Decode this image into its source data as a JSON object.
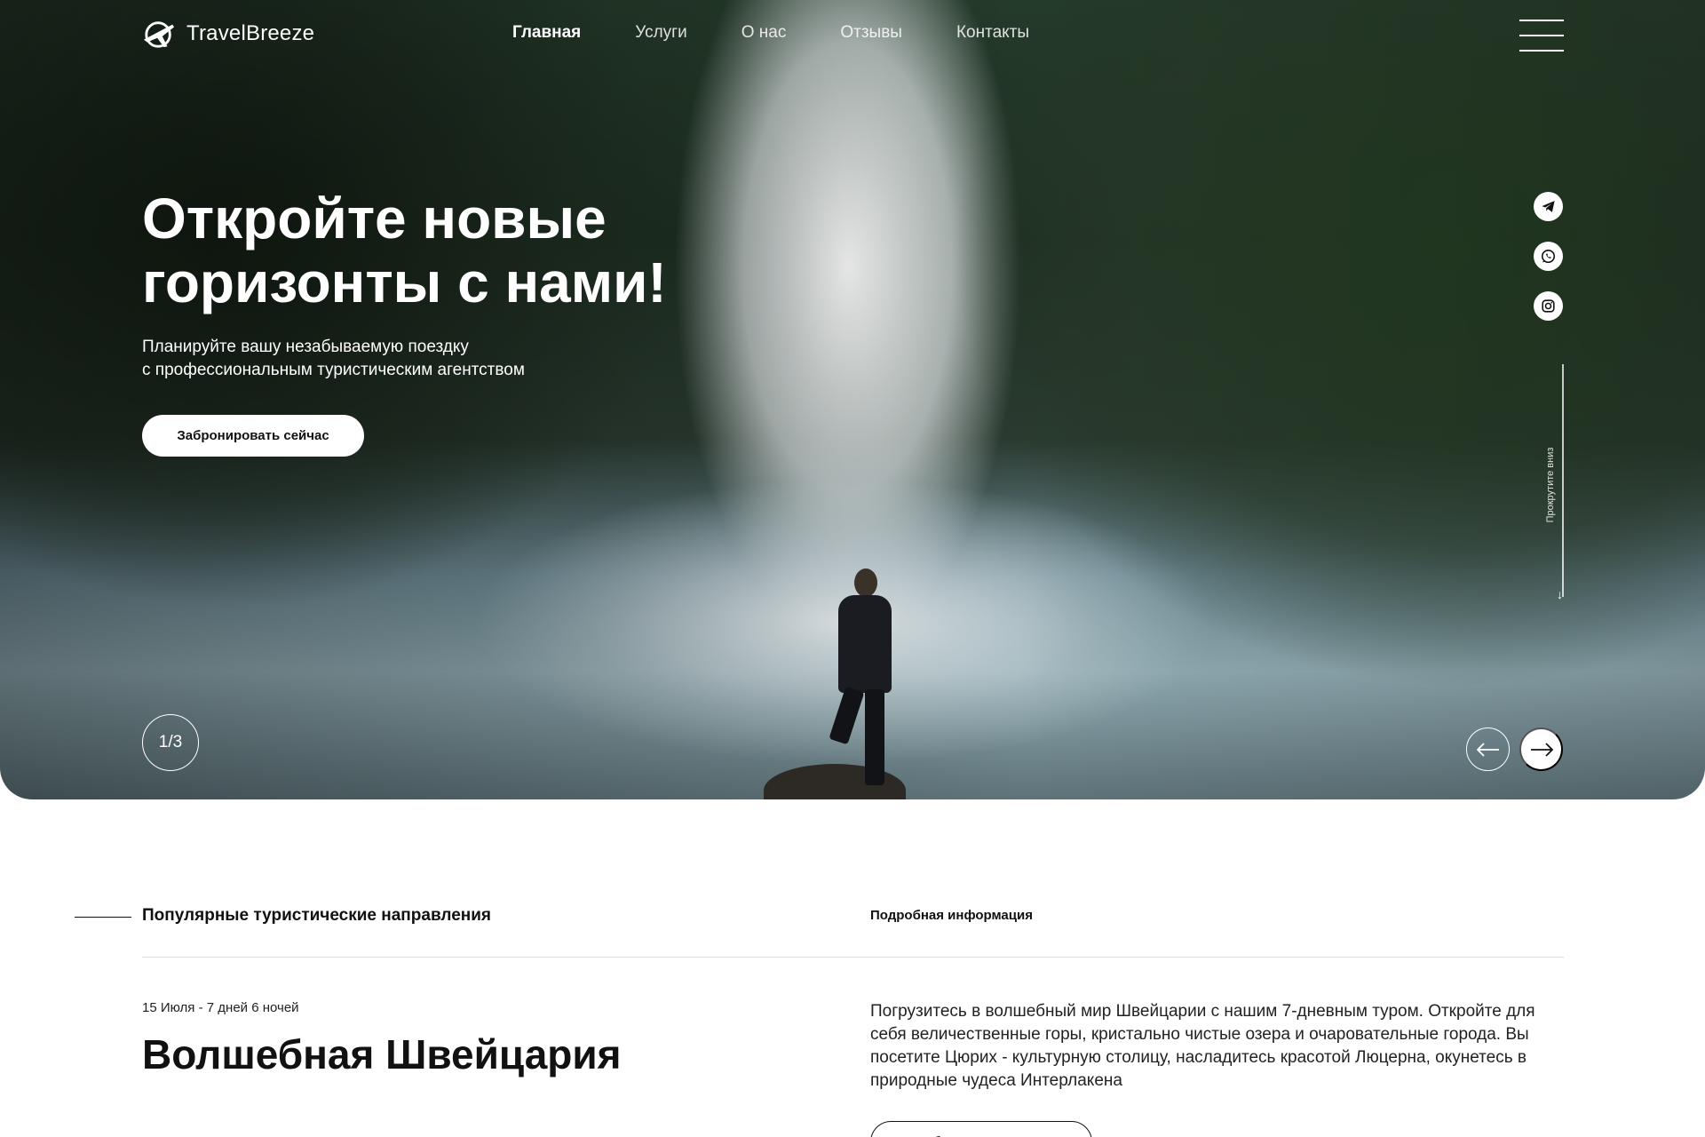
{
  "brand": {
    "name": "TravelBreeze",
    "logo_icon": "plane-globe-icon"
  },
  "nav": {
    "items": [
      {
        "label": "Главная",
        "active": true
      },
      {
        "label": "Услуги",
        "active": false
      },
      {
        "label": "О нас",
        "active": false
      },
      {
        "label": "Отзывы",
        "active": false
      },
      {
        "label": "Контакты",
        "active": false
      }
    ],
    "menu_icon": "hamburger-menu-icon"
  },
  "hero": {
    "title": "Откройте новые горизонты с нами!",
    "subtitle_line1": "Планируйте вашу незабываемую поездку",
    "subtitle_line2": "с профессиональным туристическим агентством",
    "cta_label": "Забронировать сейчас",
    "slide_counter": "1/3",
    "scroll_hint": "Прокрутите вниз",
    "socials": [
      "telegram-icon",
      "whatsapp-icon",
      "instagram-icon"
    ],
    "prev_icon": "arrow-left-icon",
    "next_icon": "arrow-right-icon"
  },
  "section": {
    "title": "Популярные туристические направления",
    "more_label": "Подробная информация"
  },
  "tour": {
    "date": "15 Июля",
    "duration": " - 7 дней 6 ночей",
    "title": "Волшебная Швейцария",
    "description": "Погрузитесь в волшебный мир Швейцарии с нашим 7-дневным туром. Откройте для себя величественные горы, кристально чистые озера и очаровательные города. Вы посетите Цюрих - культурную столицу, насладитесь красотой Люцерна, окунетесь в природные чудеса Интерлакена",
    "button_label": "Забронировать тур"
  },
  "colors": {
    "accent": "#ffffff",
    "text": "#111111",
    "divider": "#dcdcdc"
  }
}
